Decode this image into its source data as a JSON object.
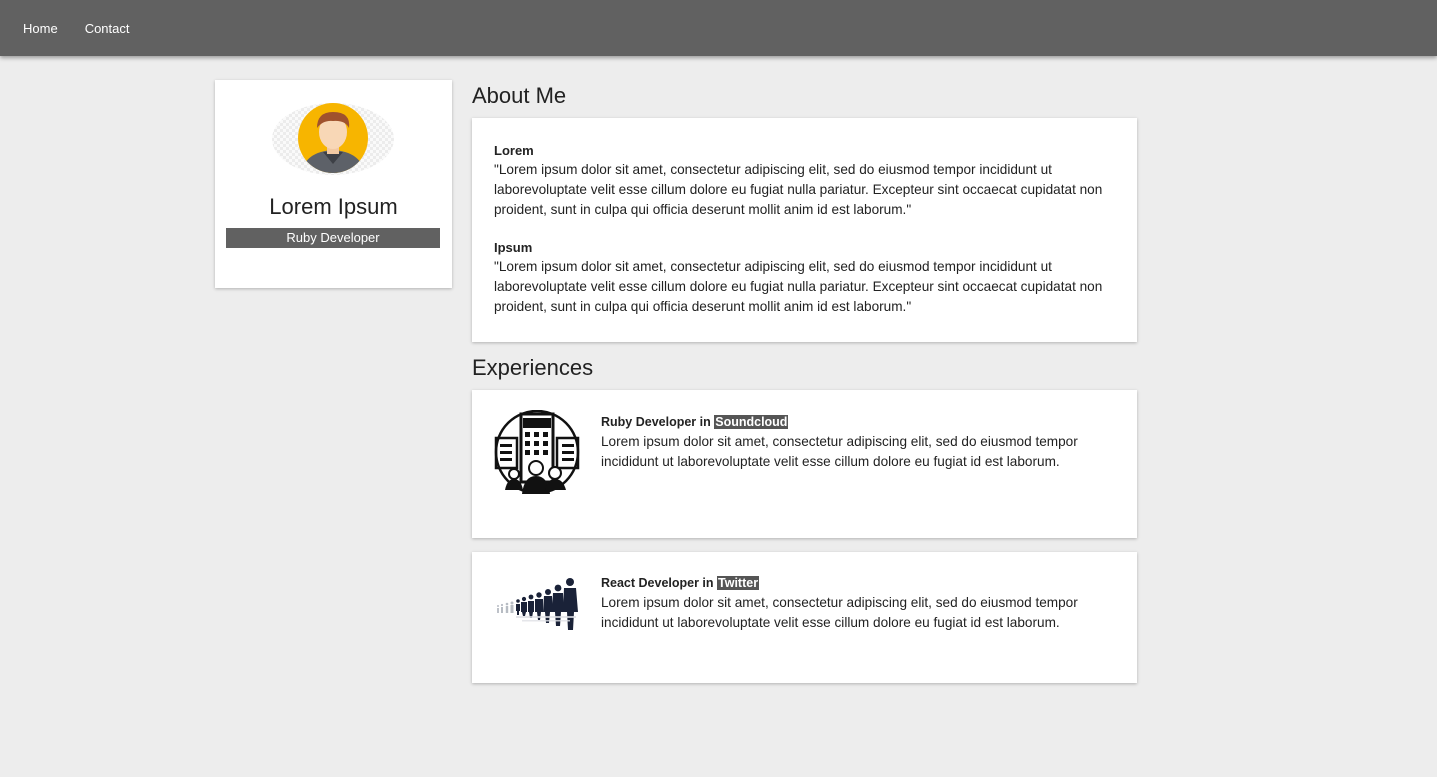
{
  "nav": {
    "items": [
      {
        "label": "Home"
      },
      {
        "label": "Contact"
      }
    ]
  },
  "profile": {
    "name": "Lorem Ipsum",
    "role": "Ruby Developer",
    "avatar_icon": "user-avatar-icon"
  },
  "about": {
    "title": "About Me",
    "blocks": [
      {
        "heading": "Lorem",
        "text": "\"Lorem ipsum dolor sit amet, consectetur adipiscing elit, sed do eiusmod tempor incididunt ut laborevoluptate velit esse cillum dolore eu fugiat nulla pariatur. Excepteur sint occaecat cupidatat non proident, sunt in culpa qui officia deserunt mollit anim id est laborum.\""
      },
      {
        "heading": "Ipsum",
        "text": "\"Lorem ipsum dolor sit amet, consectetur adipiscing elit, sed do eiusmod tempor incididunt ut laborevoluptate velit esse cillum dolore eu fugiat nulla pariatur. Excepteur sint occaecat cupidatat non proident, sunt in culpa qui officia deserunt mollit anim id est laborum.\""
      }
    ]
  },
  "experiences": {
    "title": "Experiences",
    "items": [
      {
        "role": "Ruby Developer in",
        "company": "Soundcloud",
        "text": "Lorem ipsum dolor sit amet, consectetur adipiscing elit, sed do eiusmod tempor incididunt ut laborevoluptate velit esse cillum dolore eu fugiat id est laborum.",
        "icon": "office-team-icon"
      },
      {
        "role": "React Developer in",
        "company": "Twitter",
        "text": "Lorem ipsum dolor sit amet, consectetur adipiscing elit, sed do eiusmod tempor incididunt ut laborevoluptate velit esse cillum dolore eu fugiat id est laborum.",
        "icon": "business-people-line-icon"
      }
    ]
  },
  "colors": {
    "navbar": "#616161",
    "background": "#ededed",
    "avatar_circle": "#f7b500"
  }
}
